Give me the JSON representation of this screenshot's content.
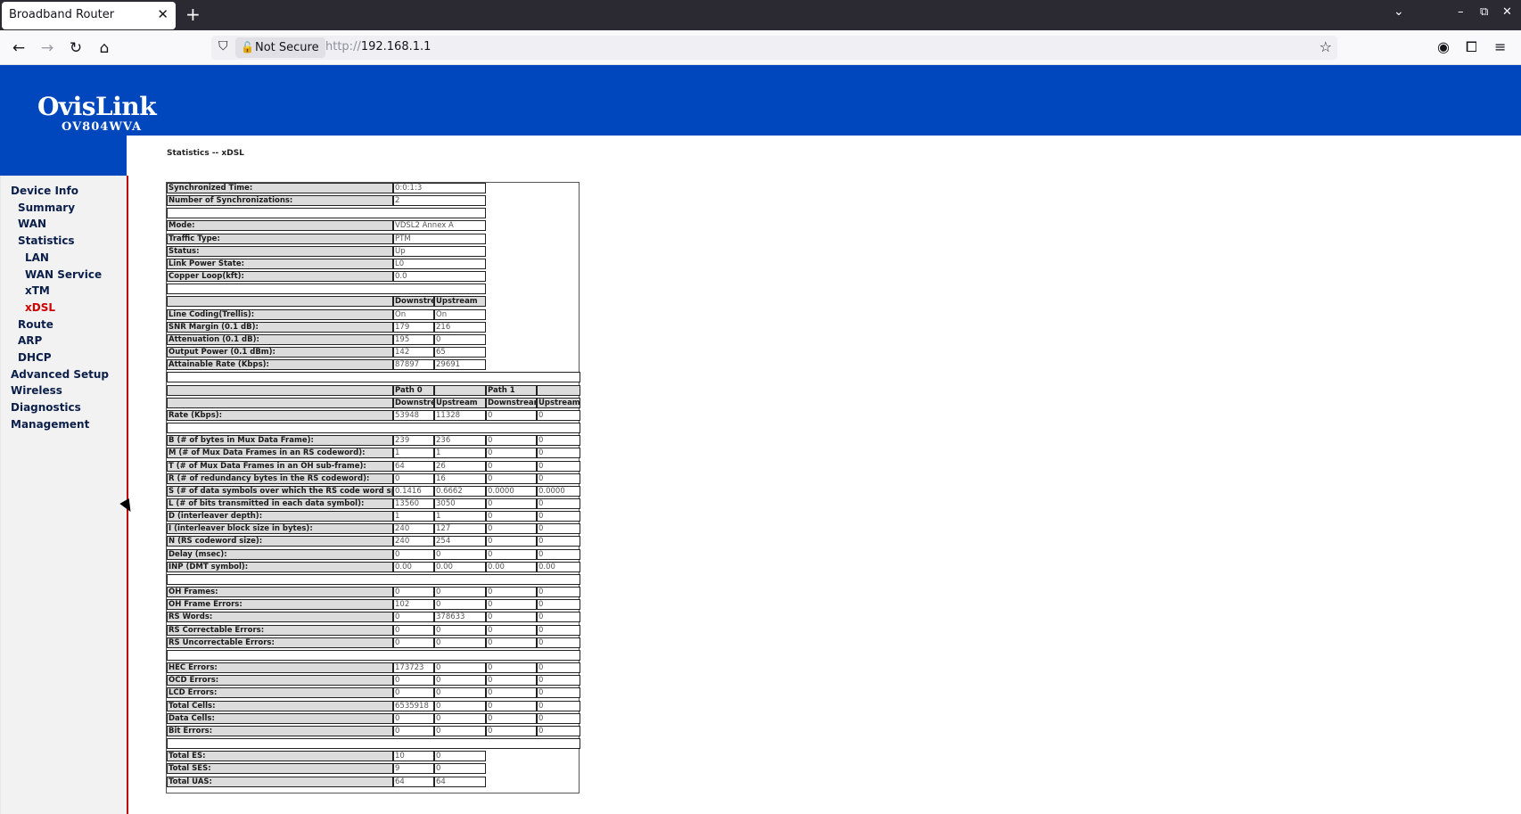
{
  "browser": {
    "tab_title": "Broadband Router",
    "not_secure": "Not Secure",
    "url_scheme": "http://",
    "url_host": "192.168.1.1"
  },
  "brand": {
    "logo": "OvisLink",
    "model": "OV804WVA"
  },
  "breadcrumb": "Statistics -- xDSL",
  "menu": [
    {
      "label": "Device Info",
      "level": 0
    },
    {
      "label": "Summary",
      "level": 1
    },
    {
      "label": "WAN",
      "level": 1
    },
    {
      "label": "Statistics",
      "level": 1
    },
    {
      "label": "LAN",
      "level": 2
    },
    {
      "label": "WAN Service",
      "level": 2
    },
    {
      "label": "xTM",
      "level": 2
    },
    {
      "label": "xDSL",
      "level": 2,
      "active": true
    },
    {
      "label": "Route",
      "level": 1
    },
    {
      "label": "ARP",
      "level": 1
    },
    {
      "label": "DHCP",
      "level": 1
    },
    {
      "label": "Advanced Setup",
      "level": 0
    },
    {
      "label": "Wireless",
      "level": 0
    },
    {
      "label": "Diagnostics",
      "level": 0
    },
    {
      "label": "Management",
      "level": 0
    }
  ],
  "colors": {
    "brand_blue": "#0046bd",
    "active_red": "#d00000"
  },
  "stats": {
    "general": [
      {
        "label": "Synchronized Time:",
        "value": "0:0:1:3"
      },
      {
        "label": "Number of Synchronizations:",
        "value": "2"
      },
      {
        "spacer": true
      },
      {
        "label": "Mode:",
        "value": "VDSL2 Annex A"
      },
      {
        "label": "Traffic Type:",
        "value": "PTM"
      },
      {
        "label": "Status:",
        "value": "Up"
      },
      {
        "label": "Link Power State:",
        "value": "L0"
      },
      {
        "label": "Copper Loop(kft):",
        "value": "0.0"
      },
      {
        "spacer": true
      }
    ],
    "line_headers": [
      "Downstream",
      "Upstream"
    ],
    "line": [
      {
        "label": "Line Coding(Trellis):",
        "values": [
          "On",
          "On"
        ]
      },
      {
        "label": "SNR Margin (0.1 dB):",
        "values": [
          "179",
          "216"
        ]
      },
      {
        "label": "Attenuation (0.1 dB):",
        "values": [
          "195",
          "0"
        ]
      },
      {
        "label": "Output Power (0.1 dBm):",
        "values": [
          "142",
          "65"
        ]
      },
      {
        "label": "Attainable Rate (Kbps):",
        "values": [
          "87897",
          "29691"
        ]
      }
    ],
    "path_headers": [
      "Path 0",
      "Path 1"
    ],
    "path_subheaders": [
      "Downstream",
      "Upstream",
      "Downstream",
      "Upstream"
    ],
    "path_groups": [
      [
        {
          "label": "Rate (Kbps):",
          "values": [
            "53948",
            "11328",
            "0",
            "0"
          ]
        }
      ],
      [
        {
          "label": "B (# of bytes in Mux Data Frame):",
          "values": [
            "239",
            "236",
            "0",
            "0"
          ]
        },
        {
          "label": "M (# of Mux Data Frames in an RS codeword):",
          "values": [
            "1",
            "1",
            "0",
            "0"
          ]
        },
        {
          "label": "T (# of Mux Data Frames in an OH sub-frame):",
          "values": [
            "64",
            "26",
            "0",
            "0"
          ]
        },
        {
          "label": "R (# of redundancy bytes in the RS codeword):",
          "values": [
            "0",
            "16",
            "0",
            "0"
          ]
        },
        {
          "label": "S (# of data symbols over which the RS code word spans):",
          "values": [
            "0.1416",
            "0.6662",
            "0.0000",
            "0.0000"
          ]
        },
        {
          "label": "L (# of bits transmitted in each data symbol):",
          "values": [
            "13560",
            "3050",
            "0",
            "0"
          ]
        },
        {
          "label": "D (interleaver depth):",
          "values": [
            "1",
            "1",
            "0",
            "0"
          ]
        },
        {
          "label": "I (interleaver block size in bytes):",
          "values": [
            "240",
            "127",
            "0",
            "0"
          ]
        },
        {
          "label": "N (RS codeword size):",
          "values": [
            "240",
            "254",
            "0",
            "0"
          ]
        },
        {
          "label": "Delay (msec):",
          "values": [
            "0",
            "0",
            "0",
            "0"
          ]
        },
        {
          "label": "INP (DMT symbol):",
          "values": [
            "0.00",
            "0.00",
            "0.00",
            "0.00"
          ]
        }
      ],
      [
        {
          "label": "OH Frames:",
          "values": [
            "0",
            "0",
            "0",
            "0"
          ]
        },
        {
          "label": "OH Frame Errors:",
          "values": [
            "102",
            "0",
            "0",
            "0"
          ]
        },
        {
          "label": "RS Words:",
          "values": [
            "0",
            "378633",
            "0",
            "0"
          ]
        },
        {
          "label": "RS Correctable Errors:",
          "values": [
            "0",
            "0",
            "0",
            "0"
          ]
        },
        {
          "label": "RS Uncorrectable Errors:",
          "values": [
            "0",
            "0",
            "0",
            "0"
          ]
        }
      ],
      [
        {
          "label": "HEC Errors:",
          "values": [
            "173723",
            "0",
            "0",
            "0"
          ]
        },
        {
          "label": "OCD Errors:",
          "values": [
            "0",
            "0",
            "0",
            "0"
          ]
        },
        {
          "label": "LCD Errors:",
          "values": [
            "0",
            "0",
            "0",
            "0"
          ]
        },
        {
          "label": "Total Cells:",
          "values": [
            "6535918",
            "0",
            "0",
            "0"
          ]
        },
        {
          "label": "Data Cells:",
          "values": [
            "0",
            "0",
            "0",
            "0"
          ]
        },
        {
          "label": "Bit Errors:",
          "values": [
            "0",
            "0",
            "0",
            "0"
          ]
        }
      ]
    ],
    "totals": [
      {
        "label": "Total ES:",
        "values": [
          "10",
          "0"
        ]
      },
      {
        "label": "Total SES:",
        "values": [
          "9",
          "0"
        ]
      },
      {
        "label": "Total UAS:",
        "values": [
          "64",
          "64"
        ]
      }
    ]
  }
}
